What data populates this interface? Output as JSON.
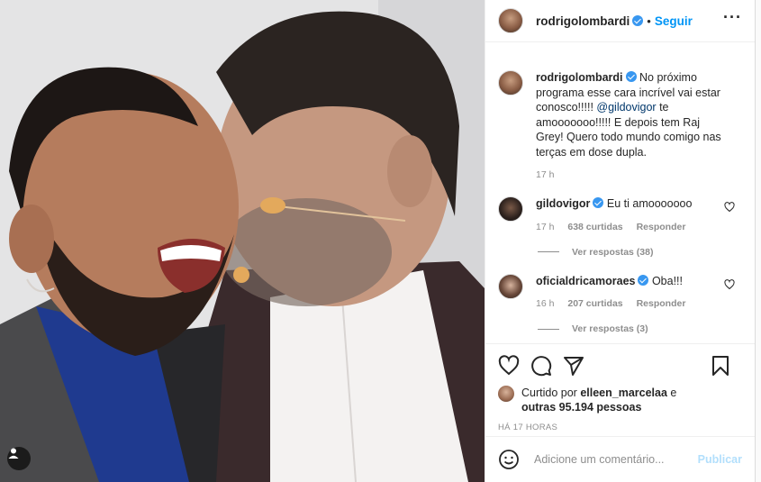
{
  "post": {
    "username": "rodrigolombardi",
    "follow_label": "Seguir",
    "dot": "•",
    "more": "···"
  },
  "caption": {
    "username": "rodrigolombardi",
    "text_before": " No próximo programa esse cara incrível vai estar conosco!!!!! ",
    "mention": "@gildovigor",
    "text_after": " te amooooooo!!!!! E depois tem Raj Grey! Quero todo mundo comigo nas terças em dose dupla.",
    "time": "17 h"
  },
  "comments": [
    {
      "username": "gildovigor",
      "text": "Eu ti amooooooo",
      "time": "17 h",
      "likes": "638 curtidas",
      "reply": "Responder",
      "view_replies": "Ver respostas (38)"
    },
    {
      "username": "oficialdricamoraes",
      "text": "Oba!!!",
      "time": "16 h",
      "likes": "207 curtidas",
      "reply": "Responder",
      "view_replies": "Ver respostas (3)"
    }
  ],
  "likes": {
    "prefix": "Curtido por ",
    "user": "elleen_marcelaa",
    "middle": " e ",
    "others": "outras 95.194 pessoas"
  },
  "timestamp": "HÁ 17 HORAS",
  "add_comment": {
    "placeholder": "Adicione um comentário...",
    "post_label": "Publicar"
  },
  "colors": {
    "accent": "#0095f6",
    "verified": "#3897f0",
    "muted": "#8e8e8e"
  }
}
